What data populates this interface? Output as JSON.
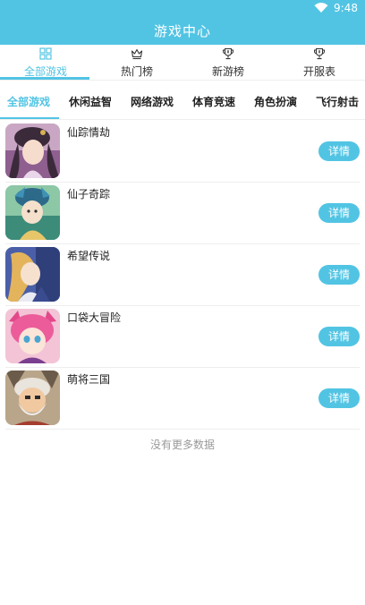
{
  "status": {
    "time": "9:48"
  },
  "header": {
    "title": "游戏中心"
  },
  "top_tabs": [
    {
      "label": "全部游戏",
      "icon": "grid-icon",
      "active": true
    },
    {
      "label": "热门榜",
      "icon": "crown-icon",
      "active": false
    },
    {
      "label": "新游榜",
      "icon": "trophy-icon",
      "active": false
    },
    {
      "label": "开服表",
      "icon": "trophy-icon",
      "active": false
    }
  ],
  "categories": [
    {
      "label": "全部游戏",
      "active": true
    },
    {
      "label": "休闲益智",
      "active": false
    },
    {
      "label": "网络游戏",
      "active": false
    },
    {
      "label": "体育竞速",
      "active": false
    },
    {
      "label": "角色扮演",
      "active": false
    },
    {
      "label": "飞行射击",
      "active": false
    }
  ],
  "games": [
    {
      "name": "仙踪情劫",
      "button": "详情"
    },
    {
      "name": "仙子奇踪",
      "button": "详情"
    },
    {
      "name": "希望传说",
      "button": "详情"
    },
    {
      "name": "口袋大冒险",
      "button": "详情"
    },
    {
      "name": "萌将三国",
      "button": "详情"
    }
  ],
  "footer": {
    "no_more": "没有更多数据"
  },
  "colors": {
    "accent": "#52c4e3",
    "text": "#222222",
    "muted": "#999999"
  }
}
